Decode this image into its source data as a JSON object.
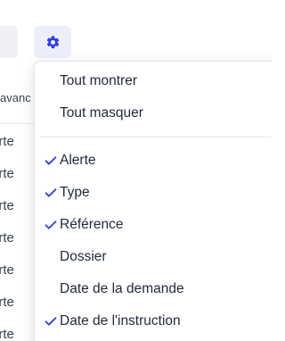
{
  "toolbar": {
    "settings_icon": "gear-icon",
    "accent": "#2f3fd8"
  },
  "table": {
    "header_fragment": "avanc",
    "cell_fragment": "erte",
    "rows": [
      "erte",
      "erte",
      "erte",
      "erte",
      "erte",
      "erte",
      "erte"
    ]
  },
  "column_menu": {
    "actions": [
      {
        "label": "Tout montrer"
      },
      {
        "label": "Tout masquer"
      }
    ],
    "columns": [
      {
        "label": "Alerte",
        "checked": true
      },
      {
        "label": "Type",
        "checked": true
      },
      {
        "label": "Référence",
        "checked": true
      },
      {
        "label": "Dossier",
        "checked": false
      },
      {
        "label": "Date de la demande",
        "checked": false
      },
      {
        "label": "Date de l'instruction",
        "checked": true
      }
    ],
    "check_icon": "check-icon",
    "check_color": "#2f3fd8"
  }
}
